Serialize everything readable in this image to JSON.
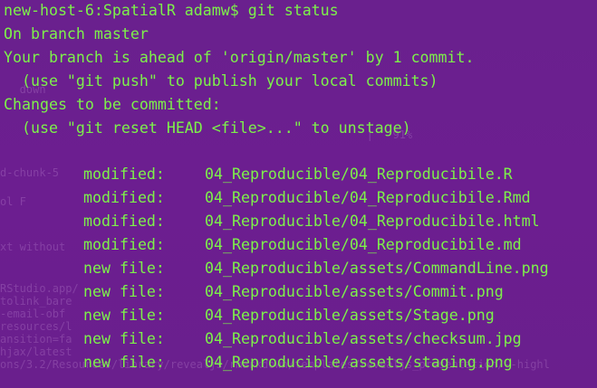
{
  "terminal": {
    "prompt": "new-host-6:SpatialR adamw$ ",
    "command": "git status",
    "branch_line": "On branch master",
    "ahead_line": "Your branch is ahead of 'origin/master' by 1 commit.",
    "push_hint": "  (use \"git push\" to publish your local commits)",
    "changes_header": "Changes to be committed:",
    "reset_hint": "  (use \"git reset HEAD <file>...\" to unstage)",
    "entries": [
      {
        "status": "modified:",
        "path": "04_Reproducible/04_Reproducibile.R"
      },
      {
        "status": "modified:",
        "path": "04_Reproducible/04_Reproducibile.Rmd"
      },
      {
        "status": "modified:",
        "path": "04_Reproducible/04_Reproducibile.html"
      },
      {
        "status": "modified:",
        "path": "04_Reproducible/04_Reproducibile.md"
      },
      {
        "status": "new file:",
        "path": "04_Reproducible/assets/CommandLine.png"
      },
      {
        "status": "new file:",
        "path": "04_Reproducible/assets/Commit.png"
      },
      {
        "status": "new file:",
        "path": "04_Reproducible/assets/Stage.png"
      },
      {
        "status": "new file:",
        "path": "04_Reproducible/assets/checksum.jpg"
      },
      {
        "status": "new file:",
        "path": "04_Reproducible/assets/staging.png"
      }
    ],
    "text_color": "#7df14a",
    "background_color": "#6b1f8f"
  }
}
